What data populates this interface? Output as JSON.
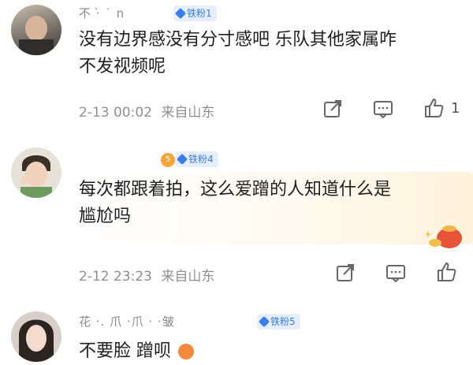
{
  "comments": [
    {
      "username": "不 ·̀ ˙ n",
      "badge": "铁粉1",
      "text_line1": "没有边界感没有分寸感吧 乐队其他家属咋",
      "text_line2": "不发视频呢",
      "time": "2-13 00:02",
      "location": "来自山东",
      "likes": "1"
    },
    {
      "username": "",
      "badge": "铁粉4",
      "vip_level": "5",
      "text_line1": "每次都跟着拍，这么爱蹭的人知道什么是",
      "text_line2": "尴尬吗",
      "time": "2-12 23:23",
      "location": "来自山东"
    },
    {
      "username": "花 ·. 爪 ·爪 · ·皱",
      "badge": "铁粉5",
      "text_line1": "不要脸 蹭呗"
    }
  ],
  "icons": {
    "share": "share-icon",
    "comment": "comment-icon",
    "like": "thumbs-up-icon",
    "reaction": "angry-face-emoji"
  },
  "colors": {
    "badge_bg": "#e6efff",
    "badge_text": "#3a7bf0",
    "meta_text": "#8f8f8f"
  }
}
